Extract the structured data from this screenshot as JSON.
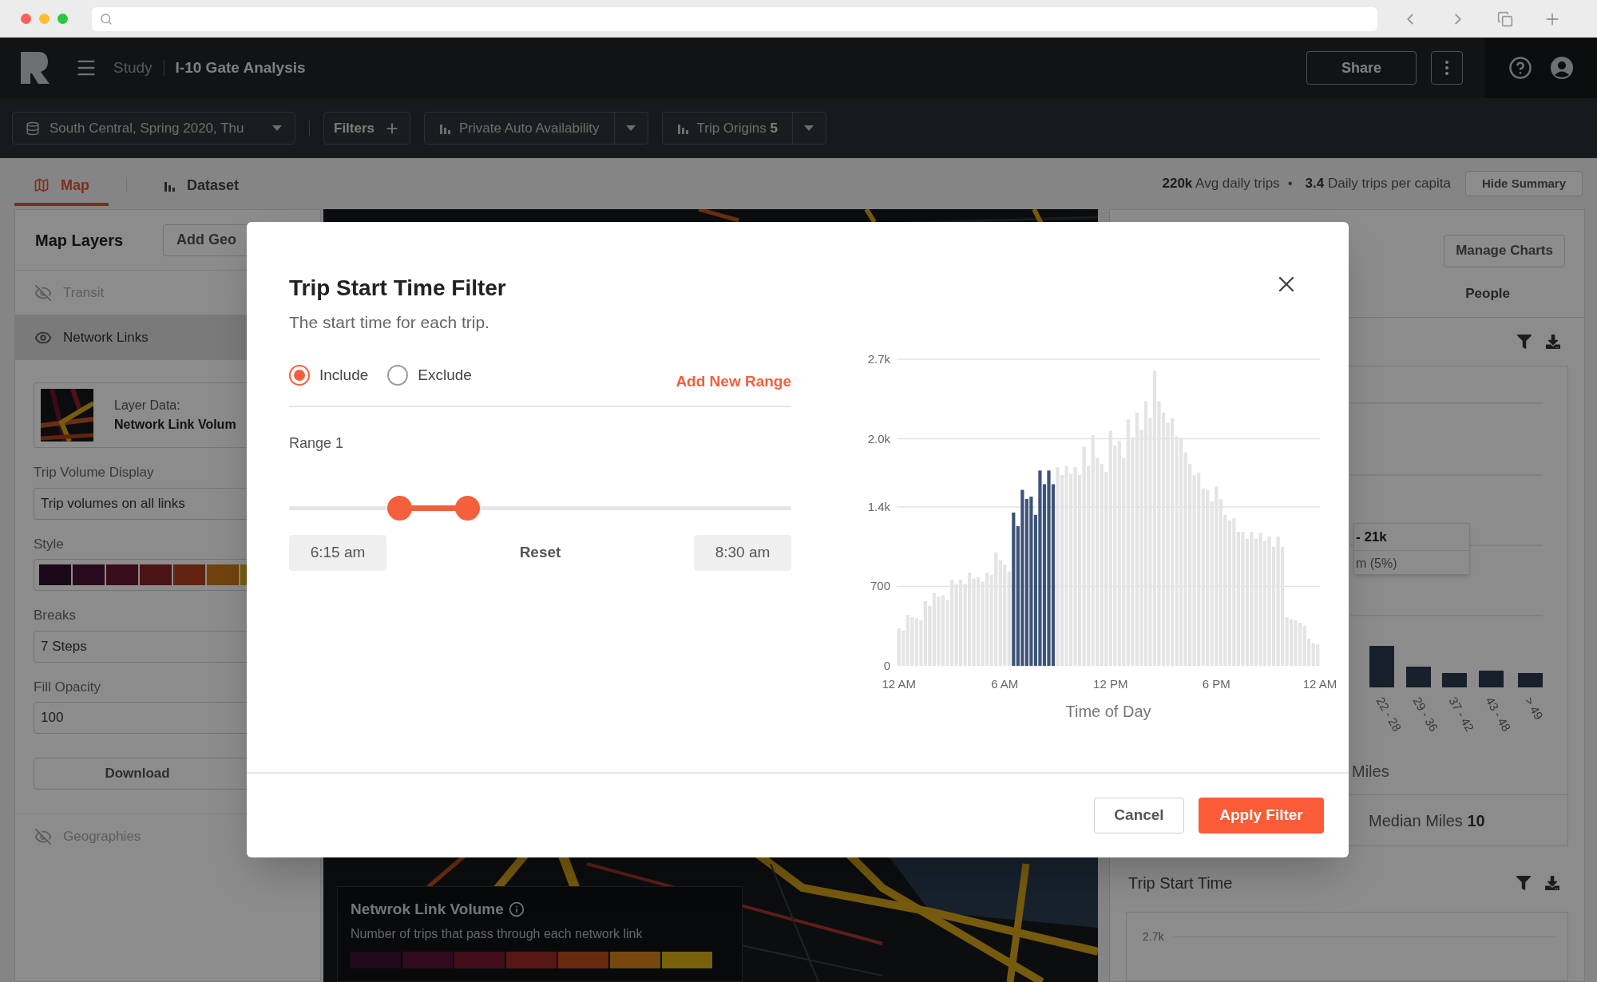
{
  "header": {
    "breadcrumb": "Study",
    "title": "I-10 Gate Analysis",
    "share": "Share"
  },
  "toolbar": {
    "dataset": "South Central, Spring 2020, Thu",
    "filters": "Filters",
    "metric": "Private Auto Availability",
    "origins": {
      "label": "Trip Origins",
      "count": "5"
    }
  },
  "view_tabs": [
    {
      "label": "Map",
      "selected": true
    },
    {
      "label": "Dataset",
      "selected": false
    }
  ],
  "summary": [
    "**220k** Avg daily trips",
    "**3.4** Daily trips per capita"
  ],
  "summary_separator": "•",
  "hide_summary": "Hide Summary",
  "map_layers": {
    "title": "Map Layers",
    "add_button": "Add Geo",
    "layers": [
      {
        "name": "Transit",
        "visible": false,
        "selected": false
      },
      {
        "name": "Network Links",
        "visible": true,
        "selected": true
      }
    ],
    "layer_data": {
      "label": "Layer Data:",
      "name": "Network Link Volum"
    },
    "volume_display": {
      "label": "Trip Volume Display",
      "value": "Trip volumes on all links"
    },
    "style": {
      "label": "Style",
      "swatches": [
        {
          "color": "#190817"
        },
        {
          "color": "#290a1c"
        },
        {
          "color": "#390c1a"
        },
        {
          "color": "#4c1315"
        },
        {
          "color": "#622311"
        },
        {
          "color": "#72430e"
        },
        {
          "color": "#775e0c"
        }
      ]
    },
    "breaks": {
      "label": "Breaks",
      "value": "7 Steps"
    },
    "opacity": {
      "label": "Fill Opacity",
      "value": "100"
    },
    "download": "Download",
    "geographies": {
      "name": "Geographies",
      "visible": false
    }
  },
  "legend": {
    "title": "Netwrok Link Volume",
    "description": "Number of trips that pass through each network link",
    "swatches": [
      {
        "color": "#200a1a"
      },
      {
        "color": "#2f0b1c"
      },
      {
        "color": "#430e1a"
      },
      {
        "color": "#561715"
      },
      {
        "color": "#692911"
      },
      {
        "color": "#75480e"
      },
      {
        "color": "#77610d"
      }
    ]
  },
  "summary_panel": {
    "manage": "Manage Charts",
    "tab": "People",
    "tooltip": {
      "value": "- 21k",
      "detail": "m (5%)"
    },
    "bins": [
      "22 - 28",
      "29 - 36",
      "37 - 42",
      "43 - 48",
      "> 49"
    ],
    "axis_label": "Miles",
    "median": {
      "label": "Median Miles",
      "value": "10"
    },
    "trip_start": {
      "title": "Trip Start Time",
      "tick": "2.7k"
    }
  },
  "modal": {
    "title": "Trip Start Time Filter",
    "subtitle": "The start time for each trip.",
    "modes": [
      {
        "label": "Include",
        "selected": true
      },
      {
        "label": "Exclude",
        "selected": false
      }
    ],
    "add_range": "Add New Range",
    "ranges": [
      {
        "label": "Range 1",
        "thumbs": [
          {
            "level": 0.219
          },
          {
            "level": 0.355
          }
        ],
        "start": "6:15 am",
        "reset": "Reset",
        "end": "8:30 am"
      }
    ],
    "chart_data": {
      "type": "bar",
      "xlabel": "Time of Day",
      "grid": true,
      "ylim": [
        0,
        2700
      ],
      "categories": [
        "12 AM",
        null,
        null,
        null,
        null,
        null,
        null,
        null,
        null,
        null,
        null,
        null,
        null,
        null,
        null,
        null,
        null,
        null,
        null,
        null,
        null,
        null,
        null,
        null,
        "6 AM",
        null,
        null,
        null,
        null,
        null,
        null,
        null,
        null,
        null,
        null,
        null,
        null,
        null,
        null,
        null,
        null,
        null,
        null,
        null,
        null,
        null,
        null,
        null,
        "12 PM",
        null,
        null,
        null,
        null,
        null,
        null,
        null,
        null,
        null,
        null,
        null,
        null,
        null,
        null,
        null,
        null,
        null,
        null,
        null,
        null,
        null,
        null,
        null,
        "6 PM",
        null,
        null,
        null,
        null,
        null,
        null,
        null,
        null,
        null,
        null,
        null,
        null,
        null,
        null,
        null,
        null,
        null,
        null,
        null,
        null,
        null,
        null,
        null
      ],
      "yticks": [
        {
          "value": 0,
          "label": "0"
        },
        {
          "value": 700,
          "label": "700"
        },
        {
          "value": 1400,
          "label": "1.4k"
        },
        {
          "value": 2000,
          "label": "2.0k"
        },
        {
          "value": 2700,
          "label": "2.7k"
        }
      ],
      "series": [
        {
          "color": "#3d5379",
          "values": [
            null,
            null,
            null,
            null,
            null,
            null,
            null,
            null,
            null,
            null,
            null,
            null,
            null,
            null,
            null,
            null,
            null,
            null,
            null,
            null,
            null,
            null,
            null,
            null,
            null,
            null,
            1350,
            1230,
            1550,
            1470,
            1490,
            1330,
            1720,
            1600,
            1720,
            1600,
            null,
            null,
            null,
            null,
            null,
            null,
            null,
            null,
            null,
            null,
            null,
            null,
            null,
            null,
            null,
            null,
            null,
            null,
            null,
            null,
            null,
            null,
            null,
            null,
            null,
            null,
            null,
            null,
            null,
            null,
            null,
            null,
            null,
            null,
            null,
            null,
            null,
            null,
            null,
            null,
            null,
            null,
            null,
            null,
            null,
            null,
            null,
            null,
            null,
            null,
            null,
            null,
            null,
            null,
            null,
            null,
            null,
            null,
            null,
            null
          ]
        },
        {
          "color": "#e4e4e4",
          "values": [
            330,
            310,
            450,
            430,
            420,
            400,
            570,
            530,
            640,
            610,
            620,
            580,
            760,
            720,
            760,
            720,
            820,
            770,
            780,
            740,
            820,
            800,
            1000,
            930,
            890,
            830,
            null,
            null,
            null,
            null,
            null,
            null,
            null,
            null,
            null,
            null,
            1750,
            1680,
            1760,
            1690,
            1750,
            1680,
            1930,
            1760,
            2030,
            1830,
            1780,
            1710,
            2070,
            1940,
            1980,
            1830,
            2170,
            2010,
            2230,
            2080,
            2330,
            2180,
            2600,
            2330,
            2230,
            2140,
            2180,
            2020,
            2000,
            1880,
            1780,
            1680,
            1700,
            1560,
            1550,
            1450,
            1580,
            1470,
            1330,
            1280,
            1300,
            1180,
            1180,
            1120,
            1180,
            1120,
            1170,
            1100,
            1140,
            1050,
            1140,
            1050,
            430,
            410,
            400,
            380,
            350,
            240,
            200,
            190
          ]
        }
      ]
    },
    "end_label": "12 AM",
    "cancel": "Cancel",
    "apply": "Apply Filter"
  }
}
